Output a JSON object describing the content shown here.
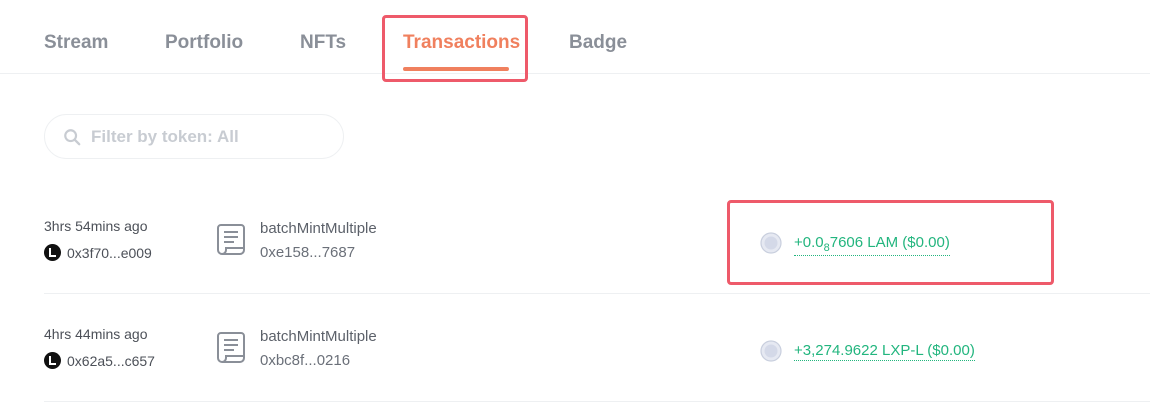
{
  "tabs": [
    {
      "label": "Stream"
    },
    {
      "label": "Portfolio"
    },
    {
      "label": "NFTs"
    },
    {
      "label": "Transactions"
    },
    {
      "label": "Badge"
    }
  ],
  "active_tab": "Transactions",
  "search": {
    "placeholder": "Filter by token: All",
    "value": ""
  },
  "transactions": [
    {
      "time": "3hrs 54mins ago",
      "from": "0x3f70...e009",
      "method": "batchMintMultiple",
      "hash": "0xe158...7687",
      "amount_prefix": "+0.0",
      "amount_sub": "8",
      "amount_rest": "7606 LAM ($0.00)"
    },
    {
      "time": "4hrs 44mins ago",
      "from": "0x62a5...c657",
      "method": "batchMintMultiple",
      "hash": "0xbc8f...0216",
      "amount": "+3,274.9622 LXP-L ($0.00)"
    }
  ],
  "colors": {
    "accent": "#f0805e",
    "highlight": "#ee5a6a",
    "positive": "#22b57e"
  }
}
